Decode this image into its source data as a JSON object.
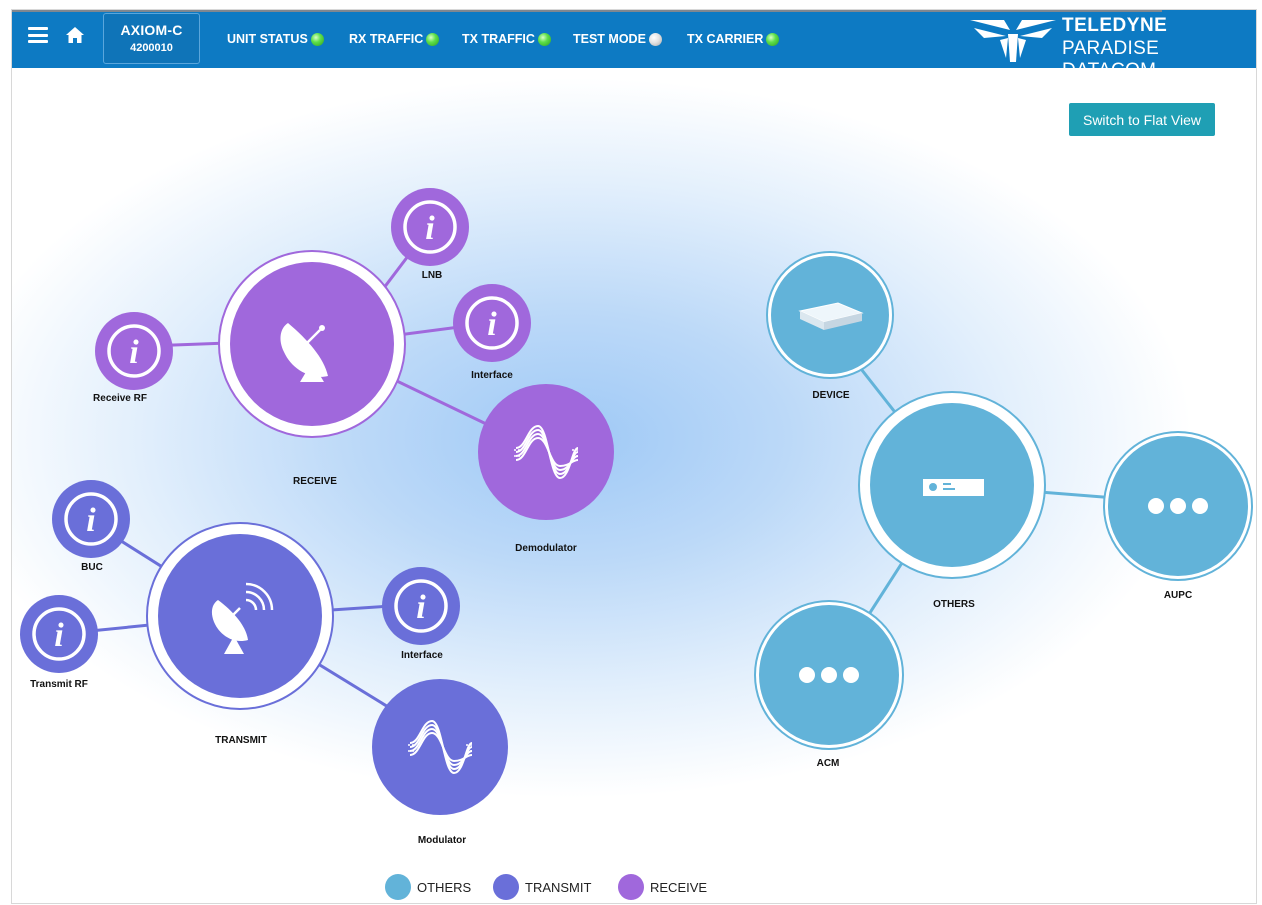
{
  "header": {
    "device": {
      "name": "AXIOM-C",
      "serial": "4200010"
    },
    "status_items": [
      {
        "label": "UNIT STATUS",
        "state": "green"
      },
      {
        "label": "RX TRAFFIC",
        "state": "green"
      },
      {
        "label": "TX TRAFFIC",
        "state": "green"
      },
      {
        "label": "TEST MODE",
        "state": "gray"
      },
      {
        "label": "TX CARRIER",
        "state": "green"
      }
    ],
    "logo": {
      "line1": "TELEDYNE",
      "line2": "PARADISE DATACOM"
    }
  },
  "toolbar": {
    "flat_view_label": "Switch to Flat View"
  },
  "nodes": {
    "receive": "RECEIVE",
    "lnb": "LNB",
    "rx_interface": "Interface",
    "receive_rf": "Receive RF",
    "demodulator": "Demodulator",
    "transmit": "TRANSMIT",
    "buc": "BUC",
    "transmit_rf": "Transmit RF",
    "tx_interface": "Interface",
    "modulator": "Modulator",
    "others": "OTHERS",
    "device": "DEVICE",
    "aupc": "AUPC",
    "acm": "ACM"
  },
  "legend": [
    {
      "label": "OTHERS",
      "color": "#62b3d9"
    },
    {
      "label": "TRANSMIT",
      "color": "#6a6fd9"
    },
    {
      "label": "RECEIVE",
      "color": "#a068dc"
    }
  ],
  "colors": {
    "header": "#0d7ac3",
    "receive": "#a068dc",
    "transmit": "#6a6fd9",
    "others": "#62b3d9",
    "button": "#1f9fb4"
  }
}
